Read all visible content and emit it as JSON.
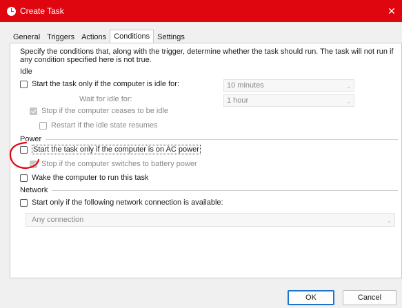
{
  "window": {
    "title": "Create Task",
    "close_glyph": "✕"
  },
  "tabs": [
    {
      "label": "General"
    },
    {
      "label": "Triggers"
    },
    {
      "label": "Actions"
    },
    {
      "label": "Conditions"
    },
    {
      "label": "Settings"
    }
  ],
  "description": "Specify the conditions that, along with the trigger, determine whether the task should run.  The task will not run  if any condition specified here is not true.",
  "idle": {
    "heading": "Idle",
    "start_idle": "Start the task only if the computer is idle for:",
    "idle_for_value": "10 minutes",
    "wait_for_idle_label": "Wait for idle for:",
    "wait_for_idle_value": "1 hour",
    "stop_if_ceases": "Stop if the computer ceases to be idle",
    "restart_if_resumes": "Restart if the idle state resumes"
  },
  "power": {
    "heading": "Power",
    "start_on_ac": "Start the task only if the computer is on AC power",
    "stop_on_battery": "Stop if the computer switches to battery power",
    "wake_to_run": "Wake the computer to run this task"
  },
  "network": {
    "heading": "Network",
    "start_if_network": "Start only if the following network connection is available:",
    "connection_value": "Any connection"
  },
  "buttons": {
    "ok": "OK",
    "cancel": "Cancel"
  },
  "colors": {
    "titlebar": "#e0060f",
    "annotation": "#e8000b"
  }
}
